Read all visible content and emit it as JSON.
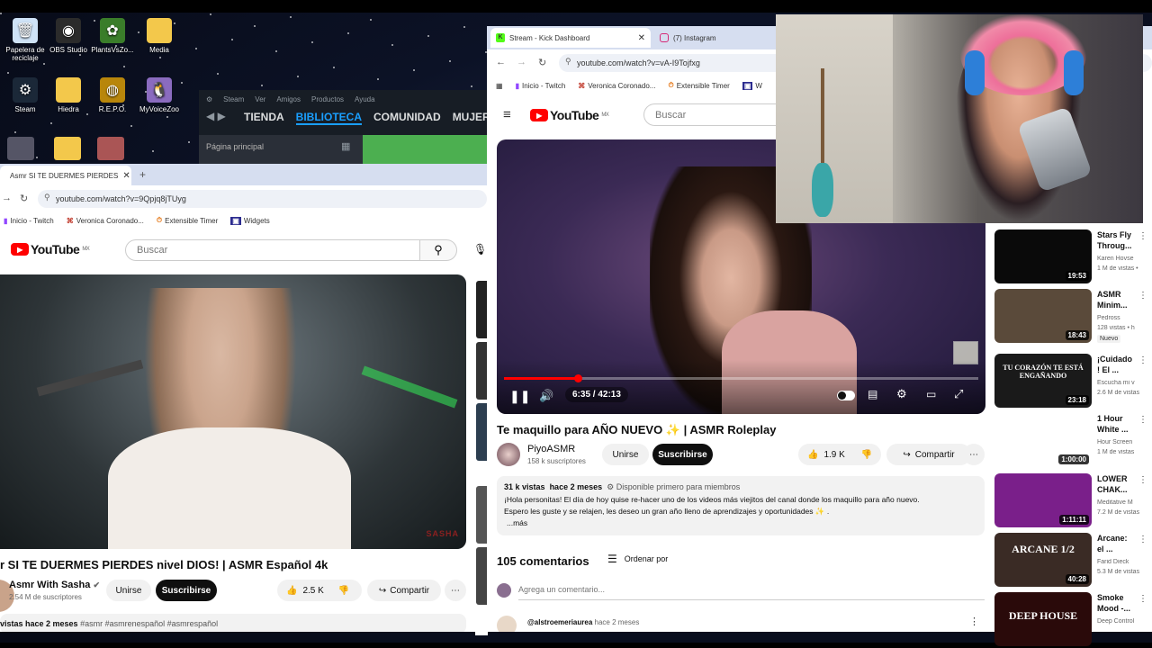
{
  "desktop": {
    "icons": [
      {
        "label": "Papelera de reciclaje",
        "icon": "recycle-bin-icon",
        "glyph": "🗑",
        "color": "#cfe3f7"
      },
      {
        "label": "OBS Studio",
        "icon": "obs-icon",
        "glyph": "◉",
        "color": "#2b2b2b"
      },
      {
        "label": "PlantsVsZo...",
        "icon": "plants-vs-zombies-icon",
        "glyph": "✿",
        "color": "#3a7d2a"
      },
      {
        "label": "Media",
        "icon": "folder-icon",
        "glyph": "",
        "color": "#f3c84b"
      },
      {
        "label": "Steam",
        "icon": "steam-icon",
        "glyph": "⚙",
        "color": "#1b2838"
      },
      {
        "label": "Hiedra",
        "icon": "folder-icon",
        "glyph": "",
        "color": "#f3c84b"
      },
      {
        "label": "R.E.P.O.",
        "icon": "repo-game-icon",
        "glyph": "◍",
        "color": "#b8860b"
      },
      {
        "label": "MyVoiceZoo",
        "icon": "myvoicezoo-icon",
        "glyph": "🐧",
        "color": "#8a6bbf"
      }
    ]
  },
  "steam": {
    "menu": [
      "Steam",
      "Ver",
      "Amigos",
      "Productos",
      "Ayuda"
    ],
    "nav": [
      "TIENDA",
      "BIBLIOTECA",
      "COMUNIDAD",
      "MUJERI"
    ],
    "home": "Página principal"
  },
  "left_browser": {
    "tab_title": "Asmr SI TE DUERMES PIERDES",
    "url": "youtube.com/watch?v=9Qpjq8jTUyg",
    "bookmarks": [
      "Inicio - Twitch",
      "Veronica Coronado...",
      "Extensible Timer",
      "Widgets"
    ],
    "search_placeholder": "Buscar",
    "logo_text": "YouTube",
    "logo_region": "MX",
    "video_title": "r SI TE DUERMES PIERDES nivel DIOS! | ASMR Español 4k",
    "channel": "Asmr With Sasha",
    "subscribers": "2.54 M de suscriptores",
    "join": "Unirse",
    "subscribe": "Suscribirse",
    "likes": "2.5 K",
    "share": "Compartir",
    "desc_line": "vistas  hace 2 meses",
    "tags": "#asmr #asmrenespañol #asmrespañol",
    "watermark": "SASHA"
  },
  "right_browser": {
    "tabs": [
      "Stream - Kick Dashboard",
      "(7) Instagram"
    ],
    "url": "youtube.com/watch?v=vA-I9Tojfxg",
    "bookmarks": [
      "Inicio - Twitch",
      "Veronica Coronado...",
      "Extensible Timer",
      "W"
    ],
    "search_placeholder": "Buscar",
    "logo_text": "YouTube",
    "logo_region": "MX",
    "time": "6:35 / 42:13",
    "progress": 0.155,
    "video_title": "Te maquillo para AÑO NUEVO ✨ | ASMR Roleplay",
    "channel": "PiyoASMR",
    "subscribers": "158 k suscriptores",
    "join": "Unirse",
    "subscribe": "Suscribirse",
    "likes": "1.9 K",
    "share": "Compartir",
    "views": "31 k vistas",
    "date": "hace 2 meses",
    "members": "Disponible primero para miembros",
    "desc1": "¡Hola personitas! El día de hoy quise re-hacer uno de los videos más viejitos del canal donde los maquillo para año nuevo.",
    "desc2": "Espero les guste y se relajen, les deseo un gran año lleno de aprendizajes y oportunidades ✨ .",
    "more": "...más",
    "comments_count": "105 comentarios",
    "sort": "Ordenar por",
    "add_comment": "Agrega un comentario...",
    "comment_user": "@alstroemeriaurea",
    "comment_time": "hace 2 meses"
  },
  "sidebar_videos": [
    {
      "title1": "Stars Fly",
      "title2": "Throug...",
      "meta1": "Karen Hovse",
      "meta2": "1 M de vistas •",
      "duration": "19:53",
      "thumb": "#0a0a0a",
      "badge": ""
    },
    {
      "title1": "ASMR",
      "title2": "Minim...",
      "meta1": "Pedross",
      "meta2": "128 vistas • h",
      "duration": "18:43",
      "thumb": "#5a4a3a",
      "badge": "Nuevo"
    },
    {
      "title1": "¡Cuidado",
      "title2": "! El ...",
      "meta1": "Escucha mi v",
      "meta2": "2.6 M de vistas",
      "duration": "23:18",
      "thumb": "#1a1a1a",
      "badge": "",
      "overlay": "TU CORAZÓN TE ESTÁ ENGAÑANDO"
    },
    {
      "title1": "1 Hour",
      "title2": "White ...",
      "meta1": "Hour Screen",
      "meta2": "1 M de vistas",
      "duration": "1:00:00",
      "thumb": "#ffffff",
      "badge": ""
    },
    {
      "title1": "LOWER",
      "title2": "CHAK...",
      "meta1": "Meditative M",
      "meta2": "7.2 M de vistas",
      "duration": "1:11:11",
      "thumb": "#7a1f8a",
      "badge": ""
    },
    {
      "title1": "Arcane:",
      "title2": "el ...",
      "meta1": "Farid Dieck",
      "meta2": "5.3 M de vistas",
      "duration": "40:28",
      "thumb": "#3a2b25",
      "badge": "",
      "overlay": "ARCANE 1/2"
    },
    {
      "title1": "Smoke",
      "title2": "Mood -...",
      "meta1": "Deep Control",
      "meta2": "",
      "duration": "",
      "thumb": "#2a0a0a",
      "badge": "",
      "overlay": "DEEP HOUSE"
    }
  ]
}
